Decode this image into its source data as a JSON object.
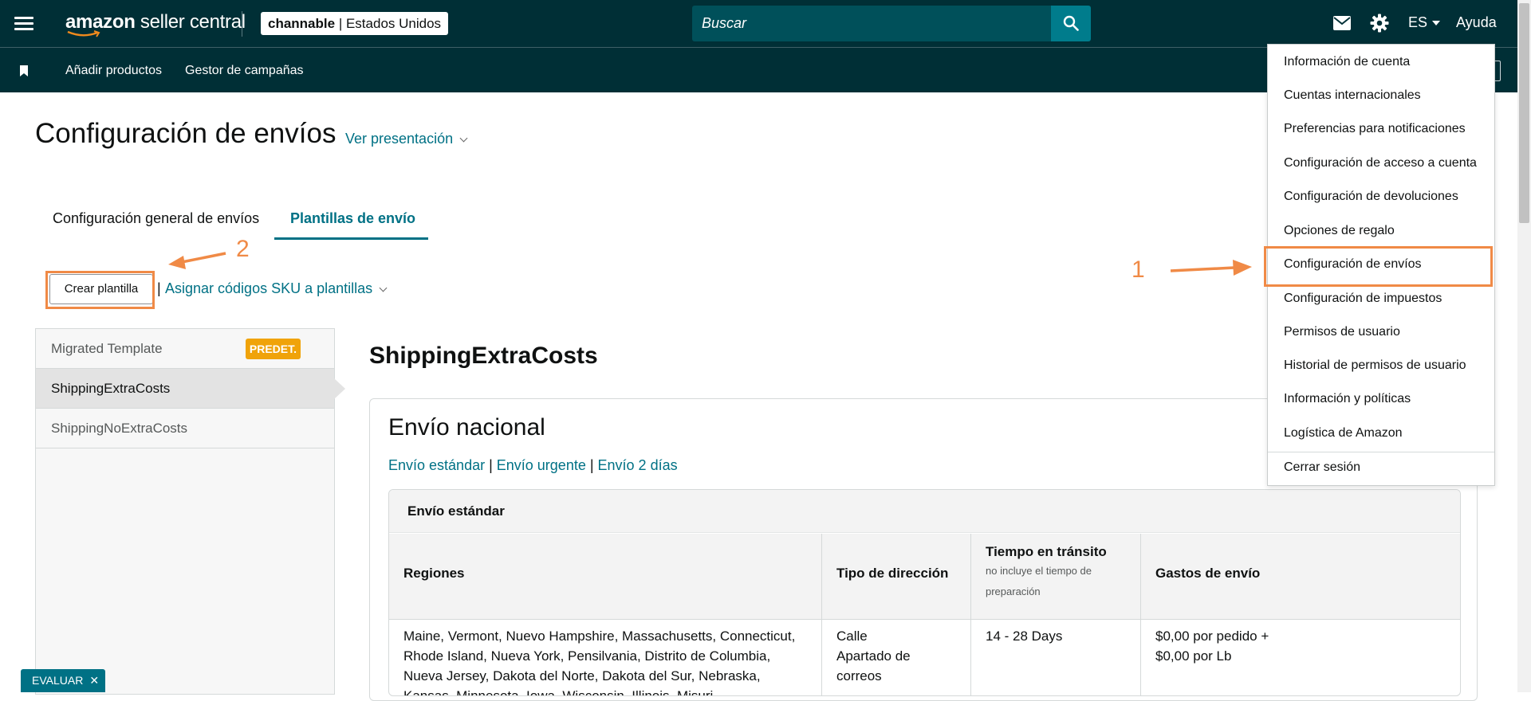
{
  "header": {
    "menu_icon": "hamburger-icon",
    "logo_primary": "amazon",
    "logo_secondary": " seller central",
    "account_name": "channable",
    "account_separator": " | ",
    "account_region": "Estados Unidos",
    "search_placeholder": "Buscar",
    "search_icon": "search-icon",
    "mail_icon": "mail-icon",
    "settings_icon": "gear-icon",
    "language": "ES",
    "help": "Ayuda"
  },
  "subnav": {
    "bookmark_icon": "bookmark-icon",
    "items": [
      "Añadir productos",
      "Gestor de campañas"
    ]
  },
  "page": {
    "title": "Configuración de envíos",
    "view_link": "Ver presentación"
  },
  "tabs": [
    {
      "label": "Configuración general de envíos",
      "active": false
    },
    {
      "label": "Plantillas de envío",
      "active": true
    }
  ],
  "actions": {
    "create_template": "Crear plantilla",
    "separator": "|",
    "assign_sku": "Asignar códigos SKU a plantillas"
  },
  "templates": [
    {
      "name": "Migrated Template",
      "badge": "PREDET."
    },
    {
      "name": "ShippingExtraCosts",
      "active": true
    },
    {
      "name": "ShippingNoExtraCosts"
    }
  ],
  "detail": {
    "template_name": "ShippingExtraCosts",
    "section_title": "Envío nacional",
    "speed_links": [
      "Envío estándar",
      "Envío urgente",
      "Envío 2 días"
    ],
    "speed_separator": " | ",
    "subsection_title": "Envío estándar",
    "columns": {
      "regions": "Regiones",
      "address_type": "Tipo de dirección",
      "transit_time": "Tiempo en tránsito",
      "transit_note": "no incluye el tiempo de preparación",
      "shipping_cost": "Gastos de envío"
    },
    "row": {
      "regions": "Maine, Vermont, Nuevo Hampshire, Massachusetts, Connecticut, Rhode Island, Nueva York, Pensilvania, Distrito de Columbia, Nueva Jersey, Dakota del Norte, Dakota del Sur, Nebraska, Kansas, Minnesota, Iowa, Wisconsin, Illinois, Misuri,",
      "address_line1": "Calle",
      "address_line2": "Apartado de correos",
      "transit": "14 - 28 Days",
      "cost_line1": "$0,00 por pedido +",
      "cost_line2": "$0,00 por Lb"
    }
  },
  "settings_menu": {
    "items": [
      "Información de cuenta",
      "Cuentas internacionales",
      "Preferencias para notificaciones",
      "Configuración de acceso a cuenta",
      "Configuración de devoluciones",
      "Opciones de regalo",
      "Configuración de envíos",
      "Configuración de impuestos",
      "Permisos de usuario",
      "Historial de permisos de usuario",
      "Información y políticas",
      "Logística de Amazon"
    ],
    "logout": "Cerrar sesión"
  },
  "annotations": {
    "step1": "1",
    "step2": "2",
    "color": "#f08a46"
  },
  "feedback": {
    "label": "EVALUAR",
    "close": "✕"
  },
  "colors": {
    "header_bg": "#002f36",
    "accent": "#007185",
    "badge": "#f0a30a"
  }
}
